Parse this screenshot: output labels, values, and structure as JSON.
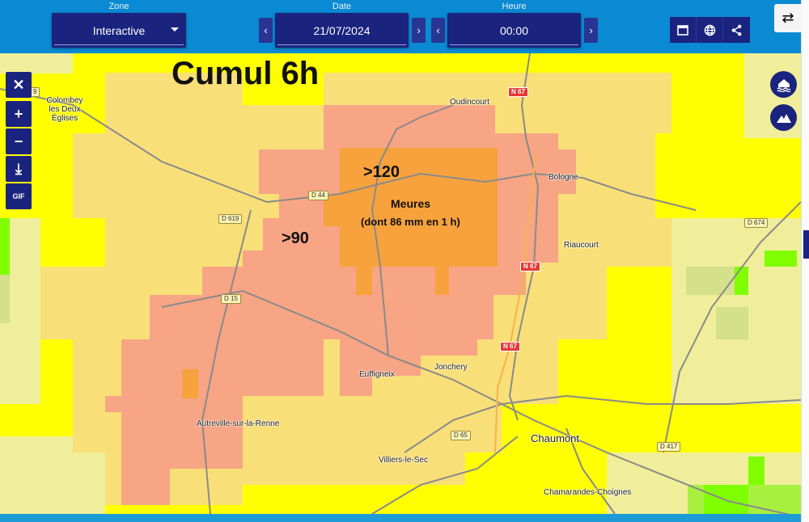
{
  "header": {
    "zone_label": "Zone",
    "zone_value": "Interactive",
    "date_label": "Date",
    "date_value": "21/07/2024",
    "hour_label": "Heure",
    "hour_value": "00:00",
    "prev": "‹",
    "next": "›",
    "tools": [
      "calendar-icon",
      "globe-icon",
      "share-icon"
    ],
    "swap": "⇄"
  },
  "map_controls": {
    "close": "✕",
    "zoom_in": "+",
    "zoom_out": "−",
    "download": "⤓",
    "gif": "GIF"
  },
  "overlay": {
    "title": "Cumul 6h",
    "label_120": ">120",
    "label_90": ">90",
    "place": "Meures",
    "note": "(dont 86 mm en 1 h)"
  },
  "towns": [
    "Colombey les Deux Églises",
    "Oudincourt",
    "Bologne",
    "Riaucourt",
    "Euffigneix",
    "Jonchery",
    "Autreville-sur-la-Renne",
    "Villiers-le-Sec",
    "Chaumont",
    "Chamarandes-Choignes"
  ],
  "roads": [
    "9",
    "N 67",
    "D 44",
    "D 619",
    "D 15",
    "D 674",
    "N 67",
    "N 67",
    "D 65",
    "D 417"
  ],
  "colors": {
    "header": "#0a8ad2",
    "button": "#1a237e",
    "yellow": "#ffff00",
    "light_orange": "#f9df78",
    "salmon": "#f7a585",
    "orange": "#f7a23c",
    "pale_yellow": "#f0ee9a",
    "green": "#80ff00"
  }
}
